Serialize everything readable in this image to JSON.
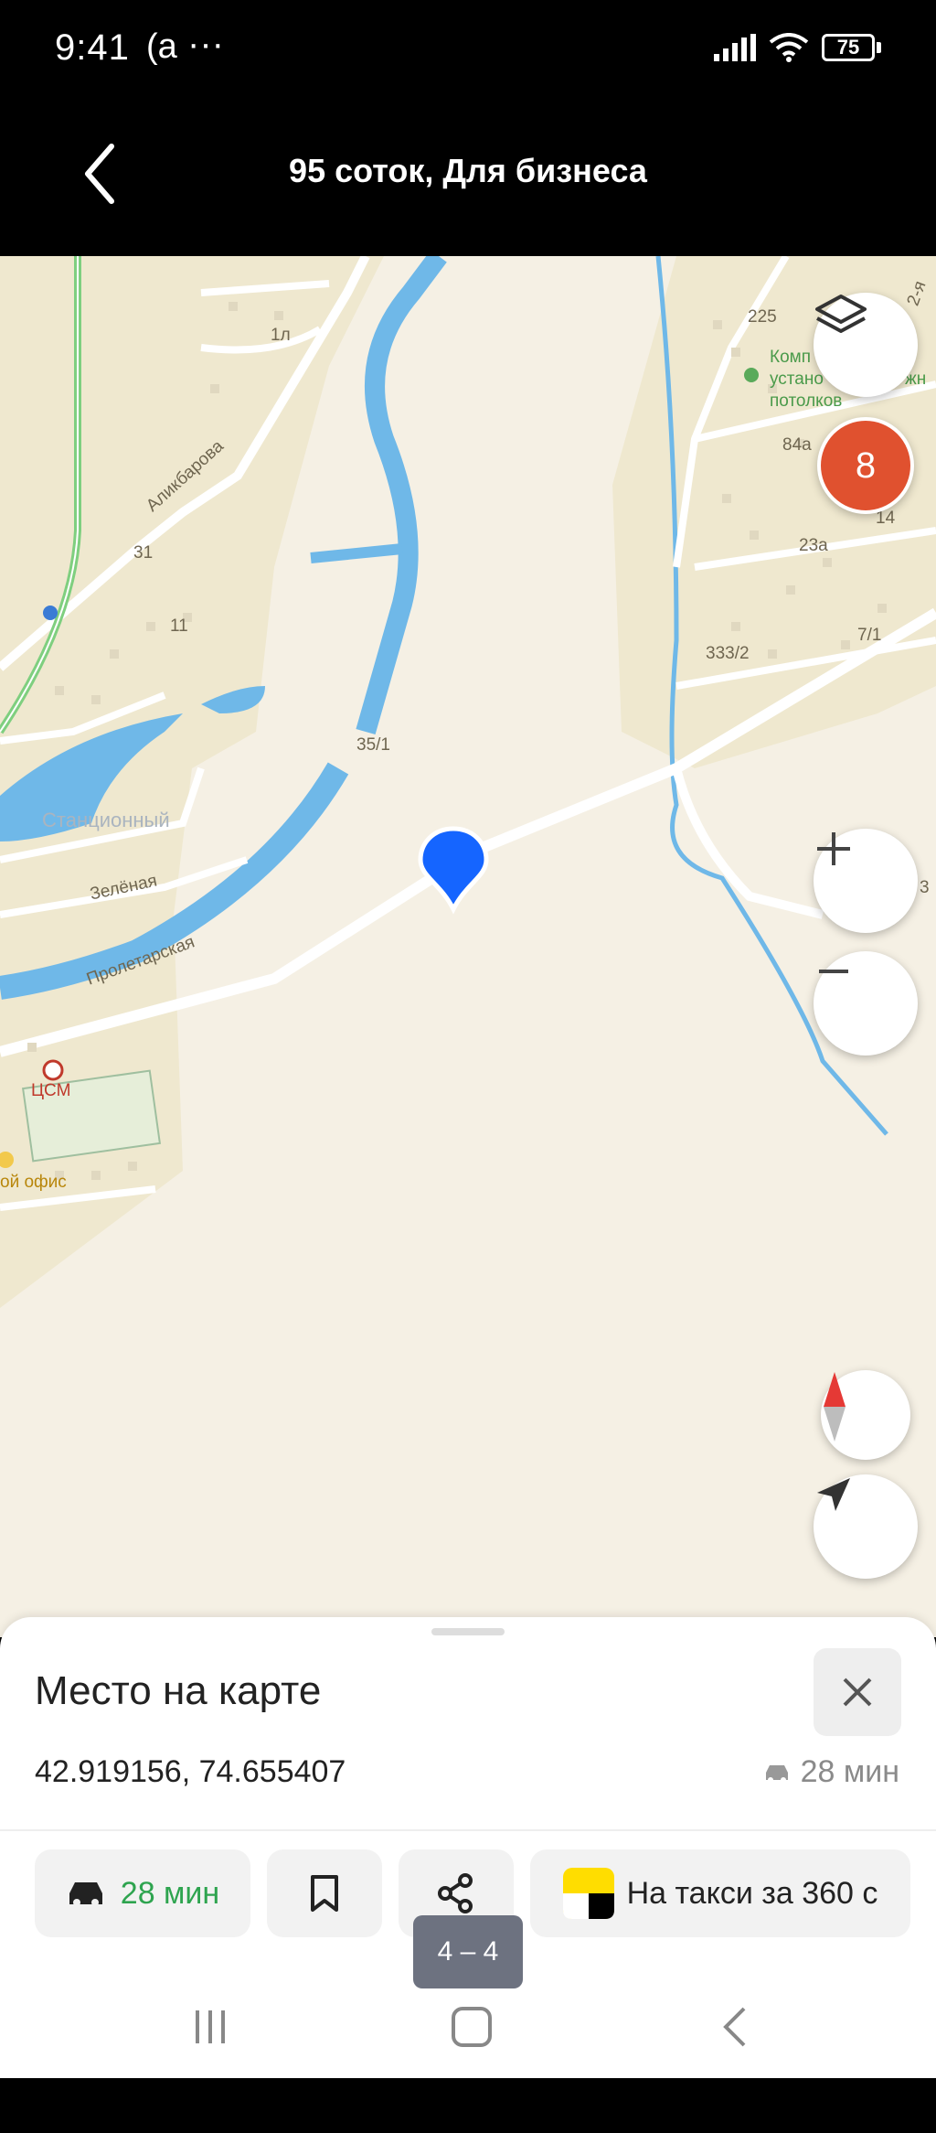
{
  "status_bar": {
    "time": "9:41",
    "extra": "(a",
    "dots": "···",
    "battery": "75"
  },
  "header": {
    "title": "95 соток, Для бизнеса"
  },
  "map": {
    "labels": {
      "alikbarova": "Аликбарова",
      "stantsionnyi": "Станционный",
      "zelenaya": "Зелёная",
      "proletarskaya": "Пролетарская",
      "tssm": "ЦСМ",
      "ofis": "ой офис",
      "kompaniya_1": "Комп",
      "kompaniya_2": "устано",
      "kompaniya_3": "потолков",
      "kompaniya_4": "жн",
      "n225": "225",
      "n84a": "84а",
      "n23a": "23а",
      "n14": "14",
      "n7_1": "7/1",
      "n333_2": "333/2",
      "n35_1": "35/1",
      "n31": "31",
      "n11": "11",
      "n1l": "1л",
      "n3": "3",
      "n2ya": "2-я"
    },
    "cluster_count": "8",
    "colors": {
      "water": "#6fb8e8",
      "marker": "#1565ff",
      "cluster": "#e0512f",
      "land": "#f5f0e4"
    }
  },
  "sheet": {
    "title": "Место на карте",
    "coordinates": "42.919156, 74.655407",
    "eta": "28 мин",
    "route_button": "28 мин",
    "taxi_button": "На такси за 360 с"
  },
  "pager": "4 – 4",
  "icons": [
    "back-arrow-icon",
    "layers-icon",
    "zoom-in-icon",
    "zoom-out-icon",
    "compass-icon",
    "locate-icon",
    "close-icon",
    "car-icon",
    "bookmark-icon",
    "share-icon",
    "taxi-icon"
  ]
}
